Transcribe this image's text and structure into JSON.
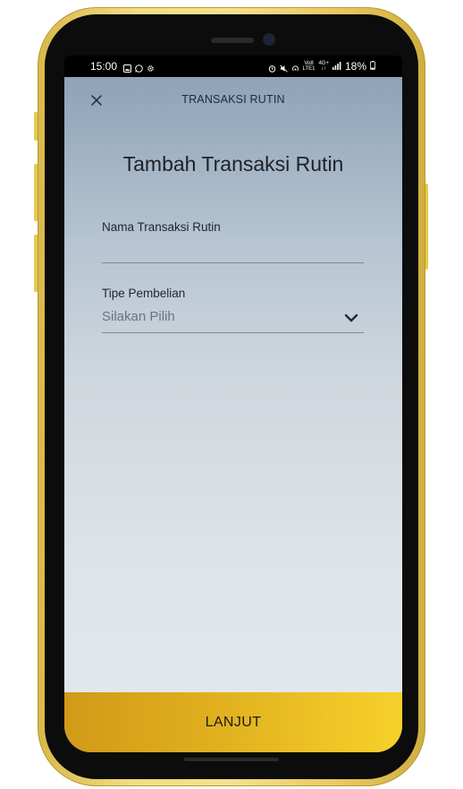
{
  "status_bar": {
    "time": "15:00",
    "battery": "18%",
    "left_icons": [
      "gallery-icon",
      "whatsapp-icon",
      "settings-icon"
    ],
    "right_icons": [
      "alarm-icon",
      "mute-icon",
      "hotspot-icon",
      "volte-icon",
      "network-icon",
      "signal-icon",
      "battery-icon"
    ],
    "volte_label_top": "Vo8",
    "volte_label_bottom": "LTE1",
    "network_label": "4G+"
  },
  "header": {
    "title": "TRANSAKSI RUTIN",
    "close_icon": "close-icon"
  },
  "page": {
    "heading": "Tambah Transaksi Rutin"
  },
  "form": {
    "name_field": {
      "label": "Nama Transaksi Rutin",
      "value": "",
      "placeholder": ""
    },
    "type_field": {
      "label": "Tipe Pembelian",
      "selected": "Silakan Pilih",
      "icon": "chevron-down-icon"
    }
  },
  "footer": {
    "button_label": "LANJUT"
  },
  "colors": {
    "accent_start": "#d19a17",
    "accent_end": "#f7d12a",
    "background_top": "#8ea3b8",
    "background_bottom": "#e4e9ed",
    "frame": "#f3dd82"
  }
}
